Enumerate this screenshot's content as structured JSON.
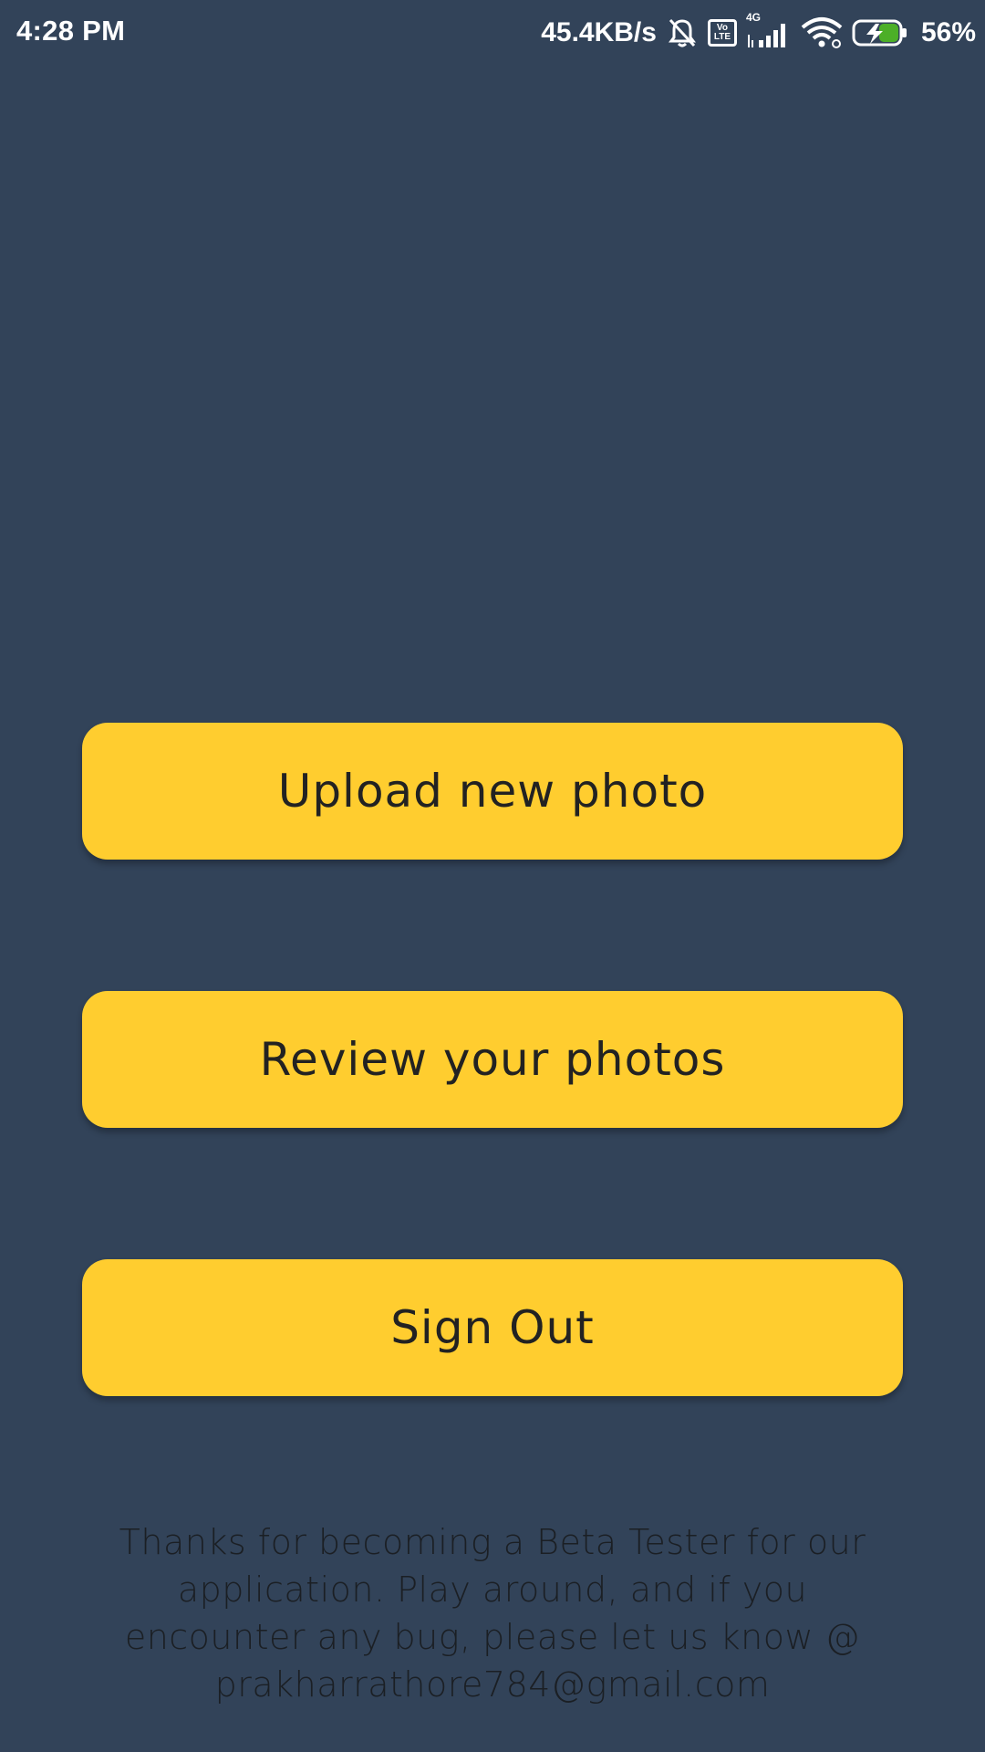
{
  "status_bar": {
    "time": "4:28 PM",
    "net_speed": "45.4KB/s",
    "volte_top": "Vo",
    "volte_bottom": "LTE",
    "network_type": "4G",
    "battery_percent": "56%",
    "icons": [
      "mute-icon",
      "volte-icon",
      "signal-icon",
      "wifi-icon",
      "battery-charging-icon"
    ]
  },
  "buttons": {
    "upload": "Upload new photo",
    "review": "Review your photos",
    "signout": "Sign Out"
  },
  "footer": {
    "message": "Thanks for becoming a Beta Tester for our application. Play around, and if you encounter any bug, please let us know @ prakharrathore784@gmail.com"
  },
  "colors": {
    "background": "#324359",
    "button": "#ffcd2f",
    "button_text": "#222222",
    "battery_fill": "#4caf27"
  }
}
